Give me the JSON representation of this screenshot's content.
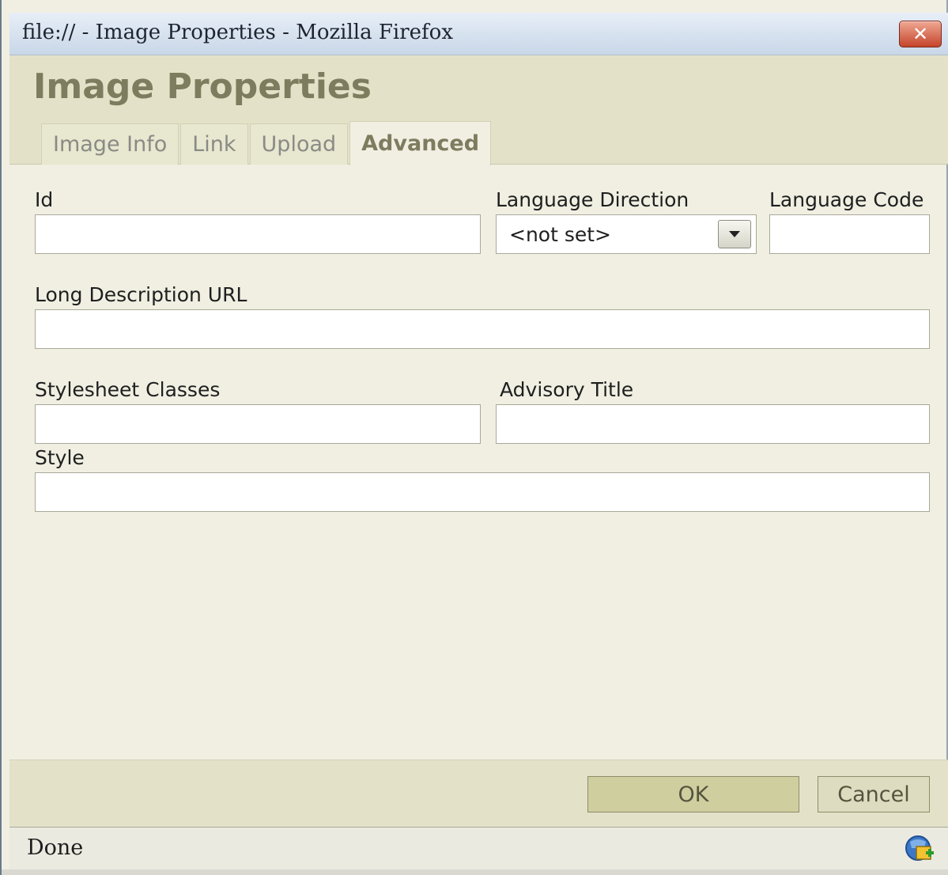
{
  "window": {
    "title": "file:// - Image Properties - Mozilla Firefox",
    "close_label": "✕"
  },
  "dialog": {
    "title": "Image Properties",
    "tabs": [
      {
        "label": "Image Info",
        "active": false
      },
      {
        "label": "Link",
        "active": false
      },
      {
        "label": "Upload",
        "active": false
      },
      {
        "label": "Advanced",
        "active": true
      }
    ]
  },
  "form": {
    "id_label": "Id",
    "id_value": "",
    "lang_dir_label": "Language Direction",
    "lang_dir_value": "<not set>",
    "lang_code_label": "Language Code",
    "lang_code_value": "",
    "longdesc_label": "Long Description URL",
    "longdesc_value": "",
    "classes_label": "Stylesheet Classes",
    "classes_value": "",
    "advisory_label": "Advisory Title",
    "advisory_value": "",
    "style_label": "Style",
    "style_value": ""
  },
  "footer": {
    "ok_label": "OK",
    "cancel_label": "Cancel"
  },
  "status": {
    "text": "Done",
    "icon": "connection-icon"
  },
  "colors": {
    "header_bg": "#e3e2c8",
    "dialog_title": "#7d7c5f",
    "close_button": "#c4442a"
  }
}
